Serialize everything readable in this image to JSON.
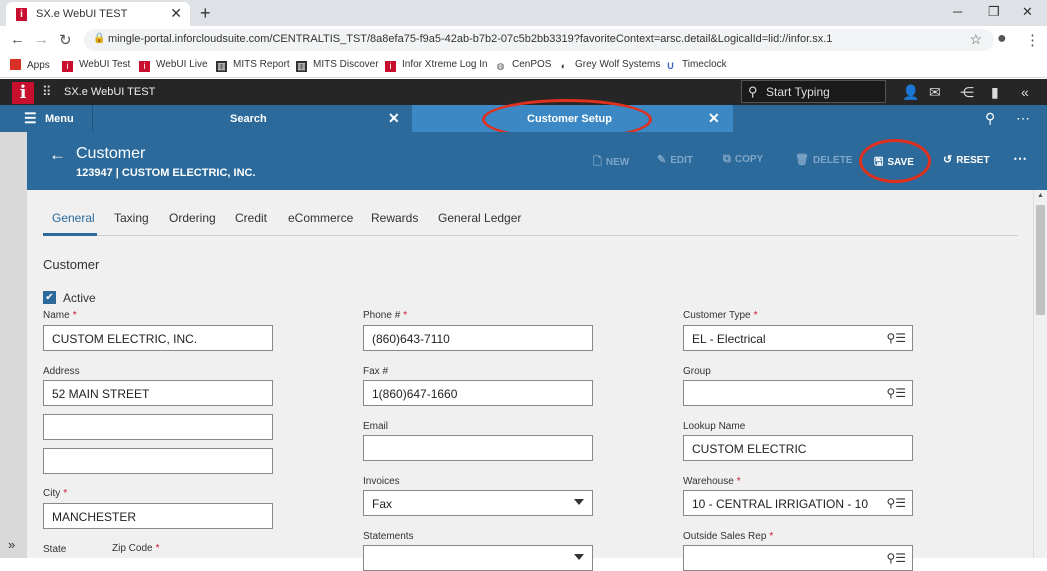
{
  "browser": {
    "tab_title": "SX.e WebUI TEST",
    "url": "mingle-portal.inforcloudsuite.com/CENTRALTIS_TST/8a8efa75-f9a5-42ab-b7b2-07c5b2bb3319?favoriteContext=arsc.detail&LogicalId=lid://infor.sx.1",
    "bookmarks": [
      {
        "label": "Apps",
        "icon": "apps-grid-icon",
        "color": "#d93025"
      },
      {
        "label": "WebUI Test",
        "icon": "infor-icon",
        "color": "#c8102e"
      },
      {
        "label": "WebUI Live",
        "icon": "infor-icon",
        "color": "#c8102e"
      },
      {
        "label": "MITS Report",
        "icon": "mits-icon",
        "color": "#333333"
      },
      {
        "label": "MITS Discover",
        "icon": "mits-icon",
        "color": "#333333"
      },
      {
        "label": "Infor Xtreme Log In",
        "icon": "infor-icon",
        "color": "#c8102e"
      },
      {
        "label": "CenPOS",
        "icon": "globe-icon",
        "color": "#555555"
      },
      {
        "label": "Grey Wolf Systems",
        "icon": "wolf-icon",
        "color": "#333333"
      },
      {
        "label": "Timeclock",
        "icon": "timeclock-icon",
        "color": "#3a66c4"
      }
    ]
  },
  "app": {
    "title": "SX.e WebUI TEST",
    "search_placeholder": "Start Typing",
    "menu_label": "Menu",
    "tabs": [
      {
        "label": "Search",
        "active": false
      },
      {
        "label": "Customer Setup",
        "active": true
      }
    ]
  },
  "page": {
    "title": "Customer",
    "subtitle": "123947 | CUSTOM ELECTRIC, INC.",
    "actions": {
      "new": "NEW",
      "edit": "EDIT",
      "copy": "COPY",
      "delete": "DELETE",
      "save": "SAVE",
      "reset": "RESET"
    }
  },
  "form_tabs": [
    "General",
    "Taxing",
    "Ordering",
    "Credit",
    "eCommerce",
    "Rewards",
    "General Ledger"
  ],
  "section_title": "Customer",
  "active_label": "Active",
  "fields": {
    "name": {
      "label": "Name",
      "value": "CUSTOM ELECTRIC, INC."
    },
    "address": {
      "label": "Address",
      "value": "52 MAIN STREET"
    },
    "address2": {
      "value": ""
    },
    "address3": {
      "value": ""
    },
    "city": {
      "label": "City",
      "value": "MANCHESTER"
    },
    "state": {
      "label": "State"
    },
    "zip": {
      "label": "Zip Code"
    },
    "phone": {
      "label": "Phone #",
      "value": "(860)643-7110"
    },
    "fax": {
      "label": "Fax #",
      "value": "1(860)647-1660"
    },
    "email": {
      "label": "Email",
      "value": ""
    },
    "invoices": {
      "label": "Invoices",
      "value": "Fax"
    },
    "statements": {
      "label": "Statements"
    },
    "customer_type": {
      "label": "Customer Type",
      "value": "EL - Electrical"
    },
    "group": {
      "label": "Group",
      "value": ""
    },
    "lookup_name": {
      "label": "Lookup Name",
      "value": "CUSTOM ELECTRIC"
    },
    "warehouse": {
      "label": "Warehouse",
      "value": "10 - CENTRAL IRRIGATION - 10"
    },
    "outside_sales_rep": {
      "label": "Outside Sales Rep"
    }
  }
}
